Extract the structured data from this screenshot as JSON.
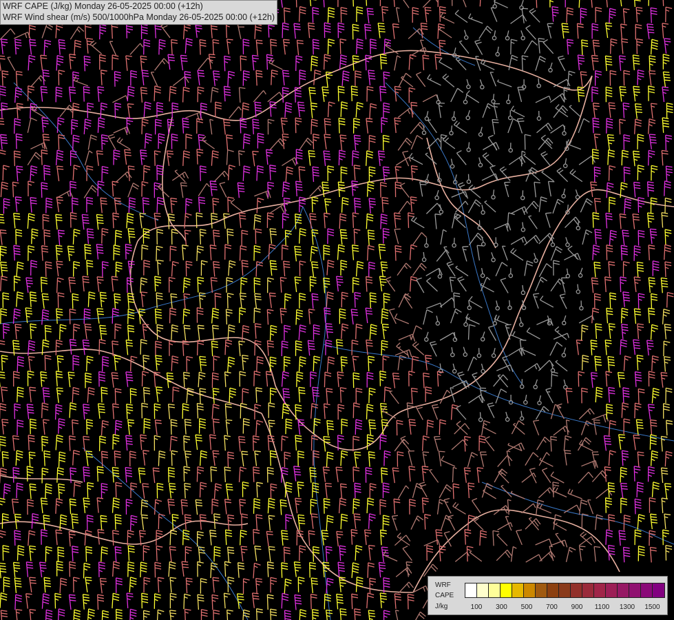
{
  "title": {
    "line1": "WRF CAPE (J/kg) Monday 26-05-2025 00:00 (+12h)",
    "line2": "WRF Wind shear (m/s) 500/1000hPa Monday 26-05-2025 00:00 (+12h)"
  },
  "legend": {
    "label_model": "WRF",
    "label_field": "CAPE",
    "label_unit": "J/kg",
    "colors": [
      "#ffffff",
      "#fefecc",
      "#fefe99",
      "#ffff00",
      "#e6b800",
      "#cc8800",
      "#a05a10",
      "#8c4010",
      "#8a3a1a",
      "#92302a",
      "#9a2a3a",
      "#a02448",
      "#9c1e56",
      "#961864",
      "#901070",
      "#8a0878",
      "#820080"
    ],
    "ticks": [
      "100",
      "300",
      "500",
      "700",
      "900",
      "1100",
      "1300",
      "1500"
    ]
  },
  "map": {
    "background": "#000000",
    "border_color": "#e8b0a0",
    "river_color": "#3a78c8",
    "barb_colors": {
      "calm": "#9a9a9a",
      "weak": "#b07a72",
      "moderate": "#e07070",
      "strong_yellow": "#ffff30",
      "strong_magenta": "#e030e0",
      "pale_yellow": "#f5e060"
    }
  }
}
